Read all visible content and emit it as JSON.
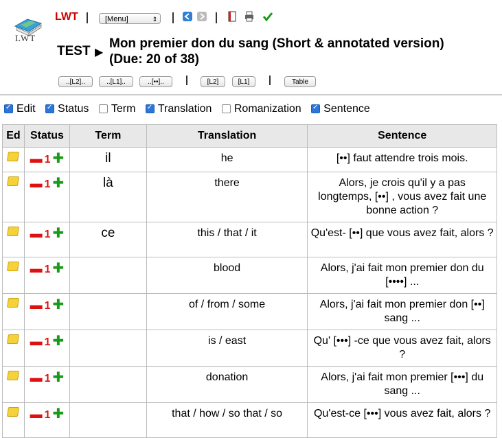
{
  "header": {
    "logo_text": "LWT",
    "app_link": "LWT",
    "menu_select": "[Menu]",
    "test_label": "TEST",
    "title_line1": "Mon premier don du sang (Short & annotated version)",
    "title_line2": "(Due: 20 of 38)",
    "buttons": [
      "..[L2]..",
      "..[L1]..",
      "..[••]..",
      "[L2]",
      "[L1]",
      "Table"
    ]
  },
  "filters": [
    {
      "label": "Edit",
      "checked": true
    },
    {
      "label": "Status",
      "checked": true
    },
    {
      "label": "Term",
      "checked": false
    },
    {
      "label": "Translation",
      "checked": true
    },
    {
      "label": "Romanization",
      "checked": false
    },
    {
      "label": "Sentence",
      "checked": true
    }
  ],
  "table": {
    "headers": [
      "Ed",
      "Status",
      "Term",
      "Translation",
      "Sentence"
    ],
    "rows": [
      {
        "status": "1",
        "term": "il",
        "translation": "he",
        "sentence": "[••] faut attendre trois mois."
      },
      {
        "status": "1",
        "term": "là",
        "translation": "there",
        "sentence": "Alors, je crois qu'il y a pas longtemps, [••] , vous avez fait une bonne action ?"
      },
      {
        "status": "1",
        "term": "ce",
        "translation": "this / that / it",
        "sentence": "Qu'est- [••] que vous avez fait, alors ?"
      },
      {
        "status": "1",
        "term": "",
        "translation": "blood",
        "sentence": "Alors, j'ai fait mon premier don du [••••] ..."
      },
      {
        "status": "1",
        "term": "",
        "translation": "of / from / some",
        "sentence": "Alors, j'ai fait mon premier don [••] sang ..."
      },
      {
        "status": "1",
        "term": "",
        "translation": "is / east",
        "sentence": "Qu' [•••] -ce que vous avez fait, alors ?"
      },
      {
        "status": "1",
        "term": "",
        "translation": "donation",
        "sentence": "Alors, j'ai fait mon premier [•••] du sang ..."
      },
      {
        "status": "1",
        "term": "",
        "translation": "that / how / so that / so",
        "sentence": "Qu'est-ce [•••] vous avez fait, alors ?"
      }
    ]
  }
}
